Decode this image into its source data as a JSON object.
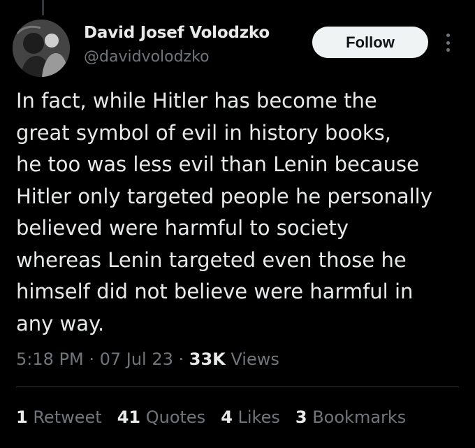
{
  "author": {
    "name": "David Josef Volodzko",
    "handle": "@davidvolodzko"
  },
  "follow_label": "Follow",
  "more_icon": "more-vertical-icon",
  "tweet": {
    "lines": [
      "In fact, while Hitler has become the",
      "great symbol of evil in history books,",
      "he too was less evil than Lenin because",
      "Hitler only targeted people he personally",
      "believed were harmful to society",
      "whereas Lenin targeted even those he",
      "himself did not believe were harmful in",
      "any way."
    ]
  },
  "meta": {
    "time": "5:18 PM",
    "sep1": " · ",
    "date": "07 Jul 23",
    "sep2": " · ",
    "views_count": "33K",
    "views_label": " Views"
  },
  "stats": {
    "retweets": {
      "count": "1",
      "label": " Retweet"
    },
    "quotes": {
      "count": "41",
      "label": " Quotes"
    },
    "likes": {
      "count": "4",
      "label": " Likes"
    },
    "bookmarks": {
      "count": "3",
      "label": " Bookmarks"
    }
  },
  "colors": {
    "background": "#000000",
    "text_primary": "#e7e9ea",
    "text_secondary": "#71767b",
    "follow_bg": "#eff3f4"
  }
}
